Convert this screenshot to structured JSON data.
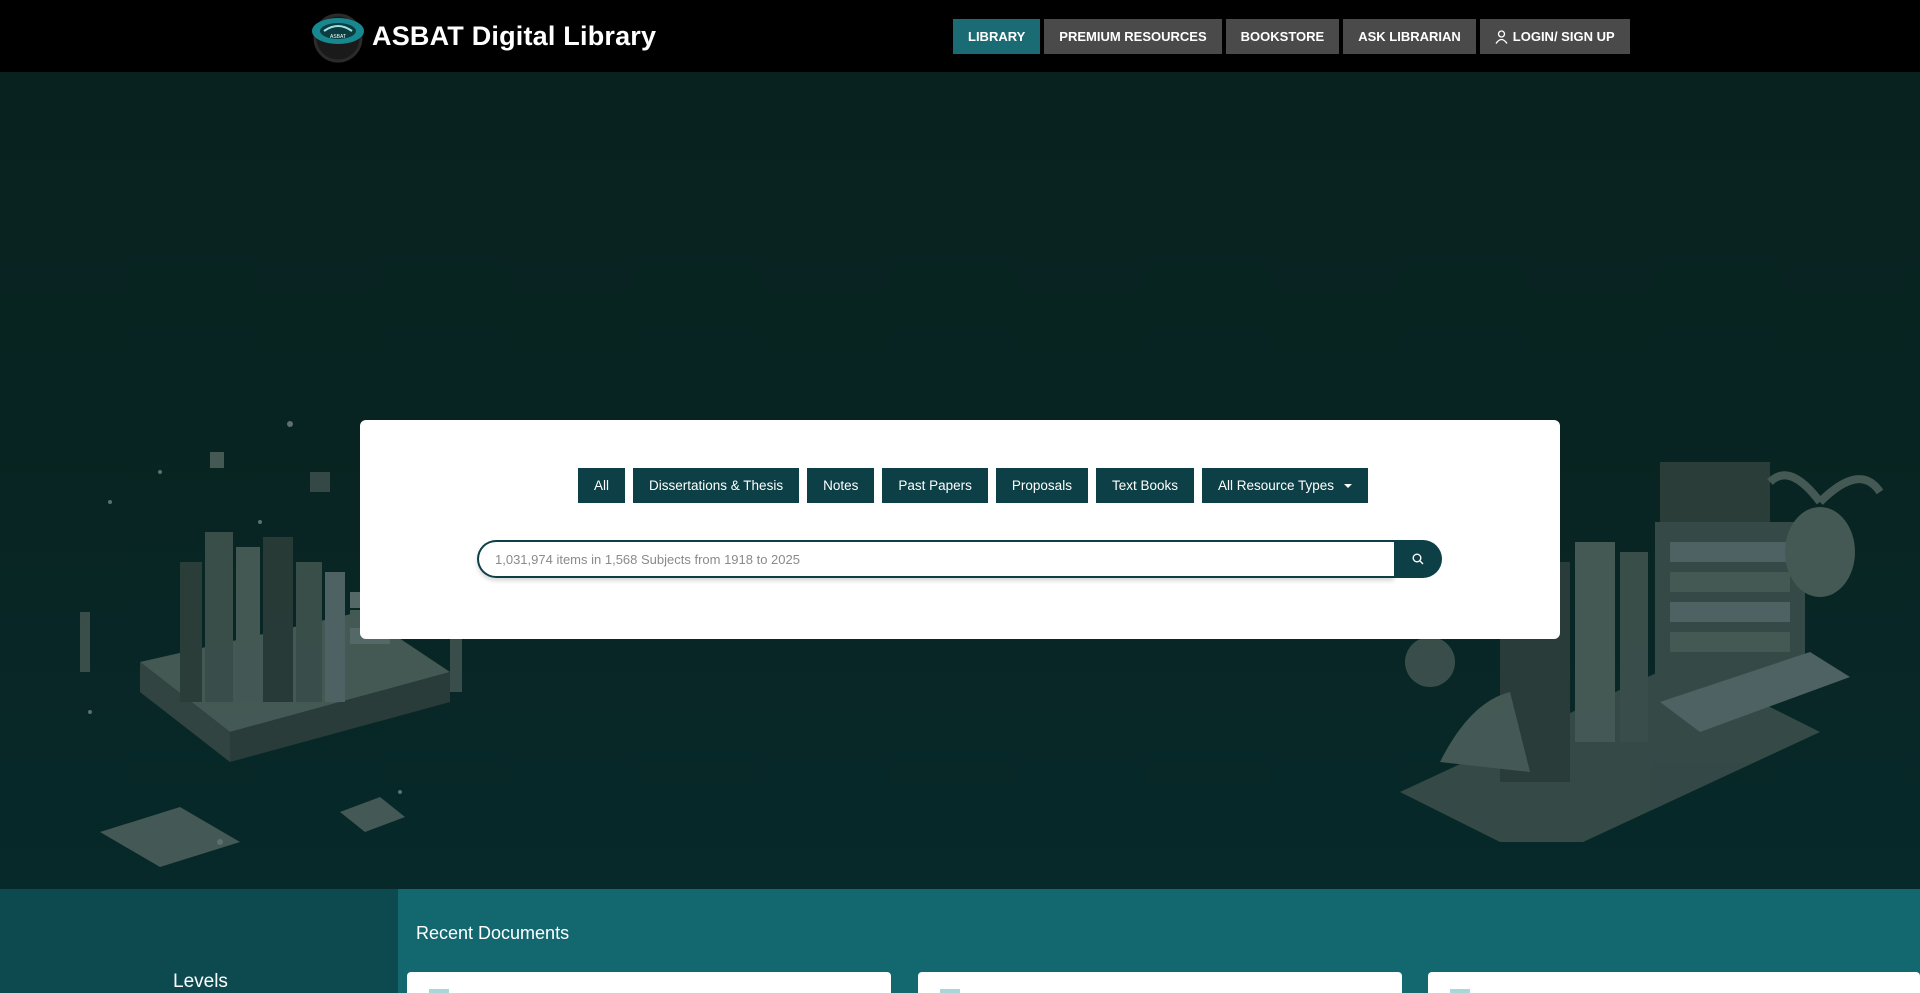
{
  "header": {
    "brand_title": "ASBAT Digital Library",
    "logo_text": "ASBAT",
    "nav": [
      {
        "label": "LIBRARY",
        "active": true
      },
      {
        "label": "PREMIUM RESOURCES",
        "active": false
      },
      {
        "label": "BOOKSTORE",
        "active": false
      },
      {
        "label": "ASK LIBRARIAN",
        "active": false
      },
      {
        "label": "LOGIN/ SIGN UP",
        "active": false,
        "icon": "user-icon"
      }
    ]
  },
  "search": {
    "filters": [
      "All",
      "Dissertations & Thesis",
      "Notes",
      "Past Papers",
      "Proposals",
      "Text Books"
    ],
    "resource_dropdown": {
      "selected": "All Resource Types",
      "icon": "caret-down-icon"
    },
    "placeholder": "1,031,974 items in 1,568 Subjects from 1918 to 2025",
    "button_icon": "search-icon"
  },
  "sections": {
    "levels_title": "Levels",
    "recent_title": "Recent Documents"
  },
  "colors": {
    "topbar": "#000000",
    "nav_active": "#1a6b74",
    "nav_default": "#4a4a4a",
    "hero_bg": "#08221f",
    "filter_btn": "#0c4046",
    "bottom_bg": "#136870",
    "levels_bg": "#0d4a50"
  }
}
